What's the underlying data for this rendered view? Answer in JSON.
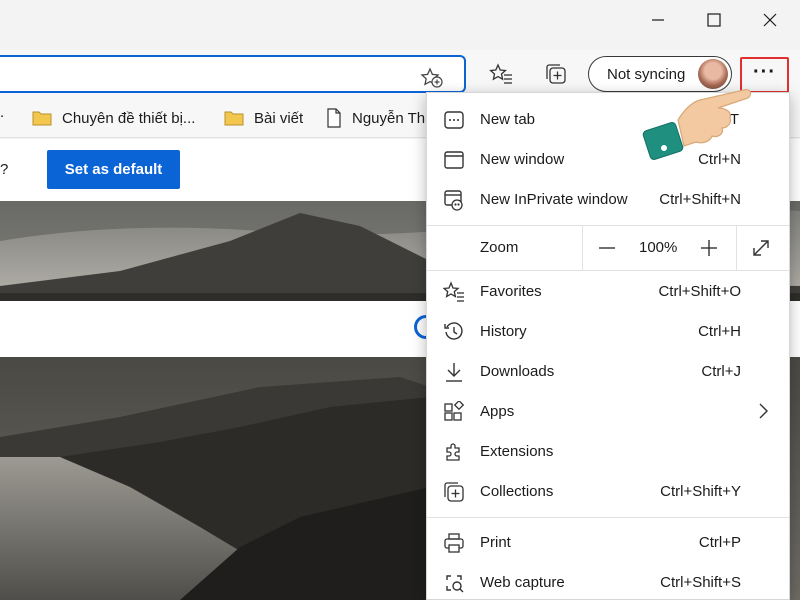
{
  "toolbar": {
    "sync_label": "Not syncing",
    "more_label": "···"
  },
  "favorites": [
    {
      "label": "Chuyên đề thiết bị...",
      "icon": "folder-icon"
    },
    {
      "label": "Bài viết",
      "icon": "folder-icon"
    },
    {
      "label": "Nguyễn Th",
      "icon": "page-icon"
    }
  ],
  "favorites_leading": ".",
  "content": {
    "question_mark": "?",
    "default_button": "Set as default"
  },
  "menu": {
    "new_tab": {
      "label": "New tab",
      "shortcut": "T"
    },
    "new_window": {
      "label": "New window",
      "shortcut": "Ctrl+N"
    },
    "inprivate": {
      "label": "New InPrivate window",
      "shortcut": "Ctrl+Shift+N"
    },
    "zoom": {
      "label": "Zoom",
      "value": "100%",
      "minus": "—",
      "plus": "+"
    },
    "favorites": {
      "label": "Favorites",
      "shortcut": "Ctrl+Shift+O"
    },
    "history": {
      "label": "History",
      "shortcut": "Ctrl+H"
    },
    "downloads": {
      "label": "Downloads",
      "shortcut": "Ctrl+J"
    },
    "apps": {
      "label": "Apps"
    },
    "extensions": {
      "label": "Extensions"
    },
    "collections": {
      "label": "Collections",
      "shortcut": "Ctrl+Shift+Y"
    },
    "print": {
      "label": "Print",
      "shortcut": "Ctrl+P"
    },
    "web_capture": {
      "label": "Web capture",
      "shortcut": "Ctrl+Shift+S"
    }
  },
  "colors": {
    "accent": "#0a64d6",
    "highlight_border": "#e03030",
    "folder": "#f3c74e"
  }
}
